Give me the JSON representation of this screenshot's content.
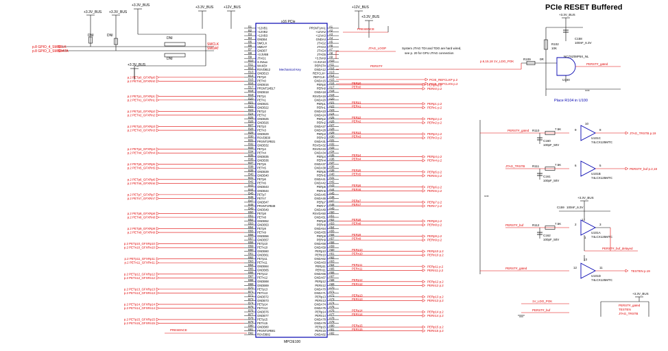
{
  "title": "PCIe RESET Buffered",
  "connector": {
    "ref": "MPCIE100",
    "name": "x16 PCIe",
    "key": "Mechanical Key",
    "b_pins": [
      {
        "n": "B1",
        "s": "+12VB1"
      },
      {
        "n": "B2",
        "s": "+12VB2"
      },
      {
        "n": "B3",
        "s": "+12VB3"
      },
      {
        "n": "B4",
        "s": "GNDB4"
      },
      {
        "n": "B5",
        "s": "SMCLK"
      },
      {
        "n": "B6",
        "s": "SMDAT"
      },
      {
        "n": "B7",
        "s": "GNDB7"
      },
      {
        "n": "B8",
        "s": "+3.3VB8"
      },
      {
        "n": "B9",
        "s": "JTAG1"
      },
      {
        "n": "B10",
        "s": "3.3Vaux"
      },
      {
        "n": "B11",
        "s": "WAKE#"
      },
      {
        "n": "B12",
        "s": "RSVDB12"
      },
      {
        "n": "B13",
        "s": "GNDB13"
      },
      {
        "n": "B14",
        "s": "PETp0"
      },
      {
        "n": "B15",
        "s": "PETn0"
      },
      {
        "n": "B16",
        "s": "GNDB16"
      },
      {
        "n": "B17",
        "s": "PRSNT2#B17"
      },
      {
        "n": "B18",
        "s": "GNDB18"
      },
      {
        "n": "B19",
        "s": "PETp1"
      },
      {
        "n": "B20",
        "s": "PETn1"
      },
      {
        "n": "B21",
        "s": "GNDB21"
      },
      {
        "n": "B22",
        "s": "GNDB22"
      },
      {
        "n": "B23",
        "s": "PETp2"
      },
      {
        "n": "B24",
        "s": "PETn2"
      },
      {
        "n": "B25",
        "s": "GNDB25"
      },
      {
        "n": "B26",
        "s": "GNDB26"
      },
      {
        "n": "B27",
        "s": "PETp3"
      },
      {
        "n": "B28",
        "s": "PETn3"
      },
      {
        "n": "B29",
        "s": "GNDB29"
      },
      {
        "n": "B30",
        "s": "RSVDB30"
      },
      {
        "n": "B31",
        "s": "PRSNT2#B31"
      },
      {
        "n": "B32",
        "s": "GNDB32"
      },
      {
        "n": "B33",
        "s": "PETp4"
      },
      {
        "n": "B34",
        "s": "PETn4"
      },
      {
        "n": "B35",
        "s": "GNDB35"
      },
      {
        "n": "B36",
        "s": "GNDB36"
      },
      {
        "n": "B37",
        "s": "PETp5"
      },
      {
        "n": "B38",
        "s": "PETn5"
      },
      {
        "n": "B39",
        "s": "GNDB39"
      },
      {
        "n": "B40",
        "s": "GNDB40"
      },
      {
        "n": "B41",
        "s": "PETp6"
      },
      {
        "n": "B42",
        "s": "PETn6"
      },
      {
        "n": "B43",
        "s": "GNDB43"
      },
      {
        "n": "B44",
        "s": "GNDB44"
      },
      {
        "n": "B45",
        "s": "PETp7"
      },
      {
        "n": "B46",
        "s": "PETn7"
      },
      {
        "n": "B47",
        "s": "GNDB47"
      },
      {
        "n": "B48",
        "s": "PRSNT2#B48"
      },
      {
        "n": "B49",
        "s": "GNDB49"
      },
      {
        "n": "B50",
        "s": "PETp8"
      },
      {
        "n": "B51",
        "s": "PETn8"
      },
      {
        "n": "B52",
        "s": "GNDB52"
      },
      {
        "n": "B53",
        "s": "GNDB53"
      },
      {
        "n": "B54",
        "s": "PETp9"
      },
      {
        "n": "B55",
        "s": "PETn9"
      },
      {
        "n": "B56",
        "s": "GNDB56"
      },
      {
        "n": "B57",
        "s": "GNDB57"
      },
      {
        "n": "B58",
        "s": "PETp10"
      },
      {
        "n": "B59",
        "s": "PETn10"
      },
      {
        "n": "B60",
        "s": "GNDB60"
      },
      {
        "n": "B61",
        "s": "GNDB61"
      },
      {
        "n": "B62",
        "s": "PETp11"
      },
      {
        "n": "B63",
        "s": "PETn11"
      },
      {
        "n": "B64",
        "s": "GNDB64"
      },
      {
        "n": "B65",
        "s": "GNDB65"
      },
      {
        "n": "B66",
        "s": "PETp12"
      },
      {
        "n": "B67",
        "s": "PETn12"
      },
      {
        "n": "B68",
        "s": "GNDB68"
      },
      {
        "n": "B69",
        "s": "GNDB69"
      },
      {
        "n": "B70",
        "s": "PETp13"
      },
      {
        "n": "B71",
        "s": "PETn13"
      },
      {
        "n": "B72",
        "s": "GNDB72"
      },
      {
        "n": "B73",
        "s": "GNDB73"
      },
      {
        "n": "B74",
        "s": "PETp14"
      },
      {
        "n": "B75",
        "s": "PETn14"
      },
      {
        "n": "B76",
        "s": "GNDB76"
      },
      {
        "n": "B77",
        "s": "GNDB77"
      },
      {
        "n": "B78",
        "s": "PETp15"
      },
      {
        "n": "B79",
        "s": "PETn15"
      },
      {
        "n": "B80",
        "s": "GNDB80"
      },
      {
        "n": "B81",
        "s": "PRSNT2#B81"
      },
      {
        "n": "B82",
        "s": "RSVDB82"
      }
    ],
    "a_pins": [
      {
        "n": "A1",
        "s": "PRSNT1#A1"
      },
      {
        "n": "A2",
        "s": "+12VA2"
      },
      {
        "n": "A3",
        "s": "+12VA3"
      },
      {
        "n": "A4",
        "s": "GNDA4"
      },
      {
        "n": "A5",
        "s": "JTAG2"
      },
      {
        "n": "A6",
        "s": "JTAG3"
      },
      {
        "n": "A7",
        "s": "JTAG4"
      },
      {
        "n": "A8",
        "s": "JTAG5"
      },
      {
        "n": "A9",
        "s": "+3.3VA9"
      },
      {
        "n": "A10",
        "s": "+3.3VA10"
      },
      {
        "n": "A11",
        "s": "PERST#"
      },
      {
        "n": "A12",
        "s": "GNDA12"
      },
      {
        "n": "A13",
        "s": "REFCLK+"
      },
      {
        "n": "A14",
        "s": "REFCLK-"
      },
      {
        "n": "A15",
        "s": "GNDA15"
      },
      {
        "n": "A16",
        "s": "PERp0"
      },
      {
        "n": "A17",
        "s": "PERn0"
      },
      {
        "n": "A18",
        "s": "GNDA18"
      },
      {
        "n": "A19",
        "s": "RSVDA19"
      },
      {
        "n": "A20",
        "s": "GNDA20"
      },
      {
        "n": "A21",
        "s": "PERp1"
      },
      {
        "n": "A22",
        "s": "PERn1"
      },
      {
        "n": "A23",
        "s": "GNDA23"
      },
      {
        "n": "A24",
        "s": "GNDA24"
      },
      {
        "n": "A25",
        "s": "PERp2"
      },
      {
        "n": "A26",
        "s": "PERn2"
      },
      {
        "n": "A27",
        "s": "GNDA27"
      },
      {
        "n": "A28",
        "s": "GNDA28"
      },
      {
        "n": "A29",
        "s": "PERp3"
      },
      {
        "n": "A30",
        "s": "PERn3"
      },
      {
        "n": "A31",
        "s": "GNDA31"
      },
      {
        "n": "A32",
        "s": "RSVDA32"
      },
      {
        "n": "A33",
        "s": "RSVDA33"
      },
      {
        "n": "A34",
        "s": "GNDA34"
      },
      {
        "n": "A35",
        "s": "PERp4"
      },
      {
        "n": "A36",
        "s": "PERn4"
      },
      {
        "n": "A37",
        "s": "GNDA37"
      },
      {
        "n": "A38",
        "s": "GNDA38"
      },
      {
        "n": "A39",
        "s": "PERp5"
      },
      {
        "n": "A40",
        "s": "PERn5"
      },
      {
        "n": "A41",
        "s": "GNDA41"
      },
      {
        "n": "A42",
        "s": "GNDA42"
      },
      {
        "n": "A43",
        "s": "PERp6"
      },
      {
        "n": "A44",
        "s": "PERn6"
      },
      {
        "n": "A45",
        "s": "GNDA45"
      },
      {
        "n": "A46",
        "s": "GNDA46"
      },
      {
        "n": "A47",
        "s": "PERp7"
      },
      {
        "n": "A48",
        "s": "PERn7"
      },
      {
        "n": "A49",
        "s": "GNDA49"
      },
      {
        "n": "A50",
        "s": "RSVDA50"
      },
      {
        "n": "A51",
        "s": "GNDA51"
      },
      {
        "n": "A52",
        "s": "PERp8"
      },
      {
        "n": "A53",
        "s": "PERn8"
      },
      {
        "n": "A54",
        "s": "GNDA54"
      },
      {
        "n": "A55",
        "s": "GNDA55"
      },
      {
        "n": "A56",
        "s": "PERp9"
      },
      {
        "n": "A57",
        "s": "PERn9"
      },
      {
        "n": "A58",
        "s": "GNDA58"
      },
      {
        "n": "A59",
        "s": "GNDA59"
      },
      {
        "n": "A60",
        "s": "PERp10"
      },
      {
        "n": "A61",
        "s": "PERn10"
      },
      {
        "n": "A62",
        "s": "GNDA62"
      },
      {
        "n": "A63",
        "s": "GNDA63"
      },
      {
        "n": "A64",
        "s": "PERp11"
      },
      {
        "n": "A65",
        "s": "PERn11"
      },
      {
        "n": "A66",
        "s": "GNDA66"
      },
      {
        "n": "A67",
        "s": "GNDA67"
      },
      {
        "n": "A68",
        "s": "PERp12"
      },
      {
        "n": "A69",
        "s": "PERn12"
      },
      {
        "n": "A70",
        "s": "GNDA70"
      },
      {
        "n": "A71",
        "s": "GNDA71"
      },
      {
        "n": "A72",
        "s": "PERp13"
      },
      {
        "n": "A73",
        "s": "PERn13"
      },
      {
        "n": "A74",
        "s": "GNDA74"
      },
      {
        "n": "A75",
        "s": "GNDA75"
      },
      {
        "n": "A76",
        "s": "PERp14"
      },
      {
        "n": "A77",
        "s": "PERn14"
      },
      {
        "n": "A78",
        "s": "GNDA78"
      },
      {
        "n": "A79",
        "s": "GNDA79"
      },
      {
        "n": "A80",
        "s": "PERp15"
      },
      {
        "n": "A81",
        "s": "PERn15"
      },
      {
        "n": "A82",
        "s": "GNDA82"
      }
    ]
  },
  "left_nets": [
    "p.2 PETp0_GFXRp0",
    "p.2 PETn0_GFXRn0",
    "p.2 PETp1_GFXRp1",
    "p.2 PETn1_GFXRn1",
    "p.2 PETp2_GFXRp2",
    "p.2 PETn2_GFXRn2",
    "p.2 PETp3_GFXRp3",
    "p.2 PETn3_GFXRn3",
    "p.2 PETp4_GFXRp4",
    "p.2 PETn4_GFXRn4",
    "p.2 PETp5_GFXRp5",
    "p.2 PETn5_GFXRn5",
    "p.2 PETp6_GFXRp6",
    "p.2 PETn6_GFXRn6",
    "p.2 PETp7_GFXRp7",
    "p.2 PETn7_GFXRn7",
    "p.2 PETp8_GFXRp8",
    "p.2 PETn8_GFXRn8",
    "p.2 PETp9_GFXRp9",
    "p.2 PETn9_GFXRn9",
    "p.2 PETp10_GFXRp10",
    "p.2 PETn10_GFXRn10",
    "p.2 PETp11_GFXRp11",
    "p.2 PETn11_GFXRn11",
    "p.2 PETp12_GFXRp12",
    "p.2 PETn12_GFXRn12",
    "p.2 PETp13_GFXRp13",
    "p.2 PETn13_GFXRn13",
    "p.2 PETp14_GFXRp14",
    "p.2 PETn14_GFXRn14",
    "p.2 PETp15_GFXRp15",
    "p.2 PETn15_GFXRn15"
  ],
  "right_nets": [
    "PERp0 p.2",
    "PERn0 p.2",
    "PERp1 p.2",
    "PERn1 p.2",
    "PERp2 p.2",
    "PERn2 p.2",
    "PERp3 p.2",
    "PERn3 p.2",
    "PERp4 p.2",
    "PERn4 p.2",
    "PERp5 p.2",
    "PERn5 p.2",
    "PERp6 p.2",
    "PERn6 p.2",
    "PERp7 p.2",
    "PERn7 p.2",
    "PERp8 p.2",
    "PERn8 p.2",
    "PERp9 p.2",
    "PERn9 p.2",
    "PERp10 p.2",
    "PERn10 p.2",
    "PERp11 p.2",
    "PERn11 p.2",
    "PERp12 p.2",
    "PERn12 p.2",
    "PERp13 p.2",
    "PERn13 p.2",
    "PERp14 p.2",
    "PERn14 p.2",
    "PERp15 p.2",
    "PERn15 p.2"
  ],
  "labels": {
    "bus33": "+3.3V_BUS",
    "bus12": "+12V_BUS",
    "dni": "DNI",
    "smbclk_in": "p.8  GPIO_4_SMBCLK",
    "smbdat_in": "p.8  GPIO_3_SMBDATA",
    "smclk": "SMCLK",
    "smdat": "SMDAT",
    "presence": "PRESENCE",
    "jtag_loop": "JTAG_LOOP",
    "jtag_note1": "System JTAG TDI and TDO are hard wired,",
    "jtag_note2": "see p. 20 for GPU JTAG connection",
    "perst": "PERST#",
    "refclkp": "PCIE_REFCLKP  p.2",
    "refclkn": "PCIE_REFCLKN  p.2",
    "bottom_presence": "PRESENCE",
    "v1_ldo_pok_in": "p.6,15,18   1V_LDO_POK",
    "r109": "R109",
    "r109_val": "0R",
    "r102": "R102",
    "r102_val": "10K",
    "c158": "C158",
    "c158_val": "100nF_6.3V",
    "u100_part": "NC7SZ08P5X_NL",
    "u100": "U100",
    "perst_gated": "PERST#_gated",
    "place_note": "Place R104 in U100",
    "u101c": "U101C",
    "u101b": "U101B",
    "u101a": "U101A",
    "u101d": "U101D",
    "part74": "74LCX125MTC",
    "r110": "R110",
    "r111": "R111",
    "r112": "R112",
    "r_val": "7.5K",
    "c160": "C160",
    "c161": "C161",
    "c162": "C162",
    "c_val": "100pF_50V",
    "c159": "C159",
    "c159_val": "100nF_6.3V",
    "jtag_trstb": "JTAG_TRSTB",
    "jtag_trstb_out": "JTAG_TRSTB  p.19",
    "perst_buf": "PERST#_buf",
    "perst_buf_out": "PERST#_buf  p.2,18",
    "perst_buf_delayed": "PERST#_buf_delayed",
    "testen": "TESTEN",
    "testen_out": "TESTEN    p.19",
    "ldo_pok": "1V_LDO_POK",
    "legend_a": "PERST#_gated",
    "legend_b": "TESTEN",
    "legend_c": "JTAG_TRSTB",
    "pins_p8": "8",
    "pins_p9": "9",
    "pins_p10": "10",
    "pins_p5": "5",
    "pins_p6": "6",
    "pins_p3": "3",
    "pins_p2": "2",
    "pins_p1": "1",
    "pins_p11": "11",
    "pins_p12": "12",
    "pins_p13": "13",
    "pins_p4": "4",
    "pins_p7": "7",
    "pins_p14": "14"
  }
}
